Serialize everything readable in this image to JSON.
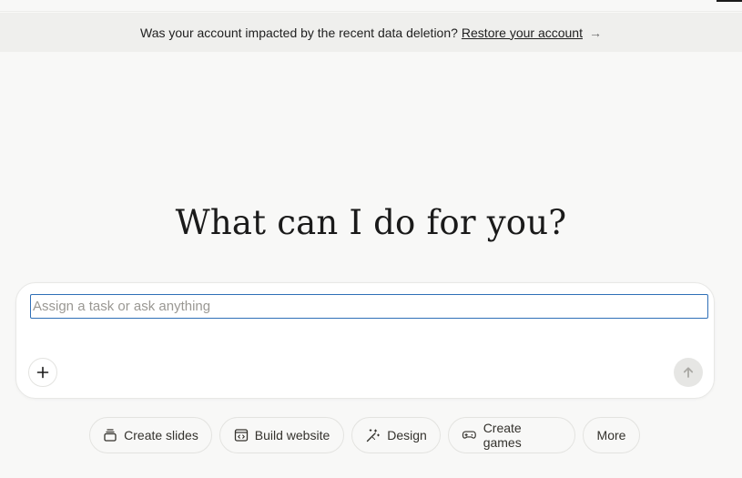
{
  "banner": {
    "message": "Was your account impacted by the recent data deletion?",
    "link_label": "Restore your account",
    "arrow": "→"
  },
  "headline": "What can I do for you?",
  "composer": {
    "placeholder": "Assign a task or ask anything",
    "value": "",
    "attach_icon": "plus-icon",
    "send_icon": "arrow-up-icon"
  },
  "quick_actions": [
    {
      "label": "Create slides",
      "icon": "slides-icon"
    },
    {
      "label": "Build website",
      "icon": "code-window-icon"
    },
    {
      "label": "Design",
      "icon": "magic-wand-icon"
    },
    {
      "label": "Create games",
      "icon": "gamepad-icon"
    },
    {
      "label": "More",
      "icon": ""
    }
  ],
  "colors": {
    "background": "#f8f8f7",
    "banner_background": "#efefed",
    "focus_border": "#2f6fb7",
    "text": "#34322d"
  }
}
